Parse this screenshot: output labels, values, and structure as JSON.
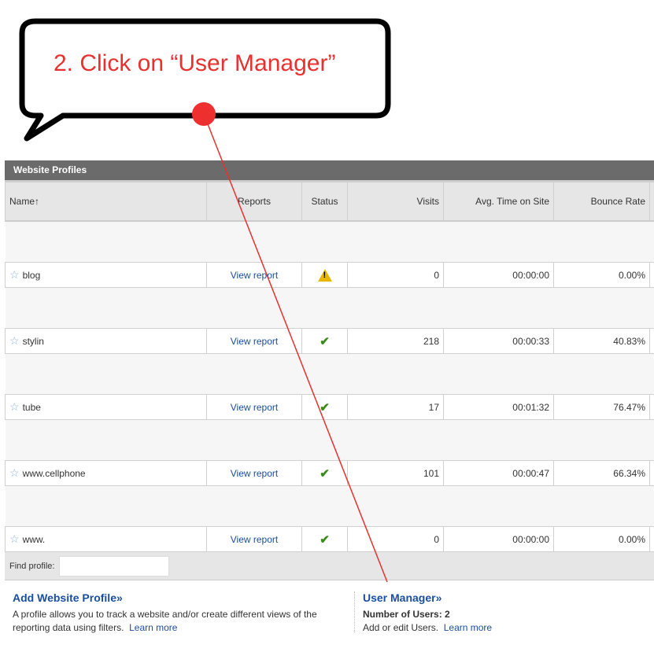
{
  "callout": {
    "text": "2. Click on “User Manager”",
    "color": "#e8312f"
  },
  "panel": {
    "title": "Website Profiles",
    "columns": [
      "Name",
      "Reports",
      "Status",
      "Visits",
      "Avg. Time on Site",
      "Bounce Rate"
    ],
    "sort_icon": "arrow-up-icon",
    "rows": [
      {
        "name": "blog",
        "report": "View report",
        "status": "warning",
        "visits": "0",
        "avg_time": "00:00:00",
        "bounce": "0.00%"
      },
      {
        "name": "stylin",
        "report": "View report",
        "status": "ok",
        "visits": "218",
        "avg_time": "00:00:33",
        "bounce": "40.83%"
      },
      {
        "name": "tube",
        "report": "View report",
        "status": "ok",
        "visits": "17",
        "avg_time": "00:01:32",
        "bounce": "76.47%"
      },
      {
        "name": "www.cellphone",
        "report": "View report",
        "status": "ok",
        "visits": "101",
        "avg_time": "00:00:47",
        "bounce": "66.34%"
      },
      {
        "name": "www.",
        "report": "View report",
        "status": "ok",
        "visits": "0",
        "avg_time": "00:00:00",
        "bounce": "0.00%"
      }
    ],
    "find_label": "Find profile:",
    "find_value": ""
  },
  "add_profile": {
    "title": "Add Website Profile»",
    "desc": "A profile allows you to track a website and/or create different views of the reporting data using filters.",
    "learn": "Learn more"
  },
  "user_manager": {
    "title": "User Manager»",
    "count": "Number of Users: 2",
    "desc": "Add or edit Users.",
    "learn": "Learn more"
  }
}
